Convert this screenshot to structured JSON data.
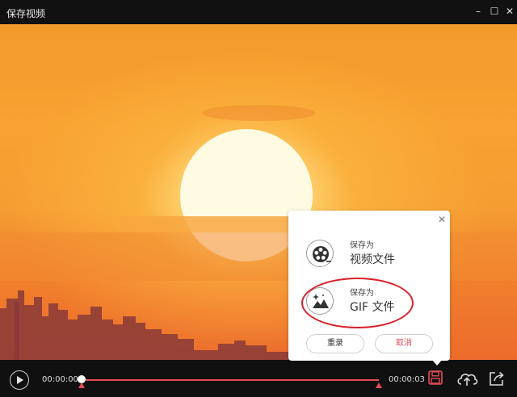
{
  "window": {
    "title": "保存视频",
    "min_label": "–",
    "max_label": "☐",
    "close_label": "✕"
  },
  "player": {
    "current_time": "00:00:00",
    "total_time": "00:00:03",
    "progress": 0
  },
  "save_popup": {
    "close_label": "✕",
    "options": [
      {
        "small_label": "保存为",
        "big_label": "视频文件",
        "icon": "film-reel-icon"
      },
      {
        "small_label": "保存为",
        "big_label": "GIF 文件",
        "icon": "gif-image-icon"
      }
    ],
    "reset_label": "重录",
    "cancel_label": "取消"
  },
  "colors": {
    "accent_red": "#e54b57",
    "highlight_red": "#d9202a",
    "titlebar_bg": "#111111",
    "controlbar_bg": "#101010"
  }
}
